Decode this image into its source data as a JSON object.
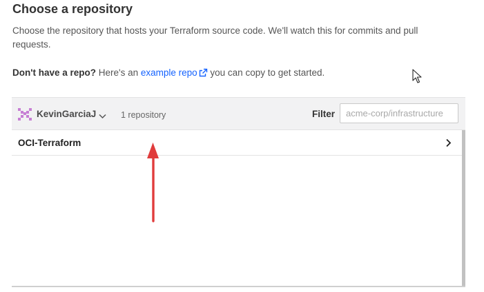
{
  "page": {
    "title": "Choose a repository",
    "description": "Choose the repository that hosts your Terraform source code. We'll watch this for commits and pull requests."
  },
  "help": {
    "bold": "Don't have a repo?",
    "prefix": " Here's an ",
    "link": "example repo",
    "suffix": " you can copy to get started."
  },
  "repo_panel": {
    "org_name": "KevinGarciaJ",
    "repo_count": "1 repository",
    "filter_label": "Filter",
    "filter_placeholder": "acme-corp/infrastructure",
    "filter_value": "",
    "repositories": [
      {
        "name": "OCI-Terraform"
      }
    ]
  },
  "colors": {
    "link": "#1563ff",
    "annotation_arrow": "#e03c3c",
    "avatar": "#c77fd4"
  },
  "icons": {
    "org_avatar": "identicon-avatar",
    "external_link": "external-link-icon",
    "dropdown": "chevron-down-icon",
    "row": "chevron-right-icon",
    "cursor": "mouse-pointer-icon",
    "annotation": "red-arrow-annotation"
  }
}
